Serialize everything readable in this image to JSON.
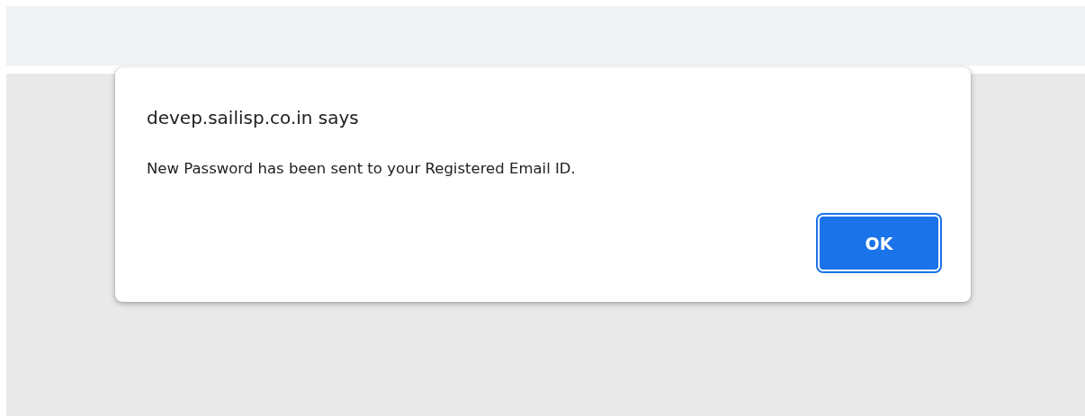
{
  "dialog": {
    "title": "devep.sailisp.co.in says",
    "message": "New Password has been sent to your Registered Email ID.",
    "buttons": [
      {
        "label": "OK",
        "focused": true
      }
    ]
  }
}
